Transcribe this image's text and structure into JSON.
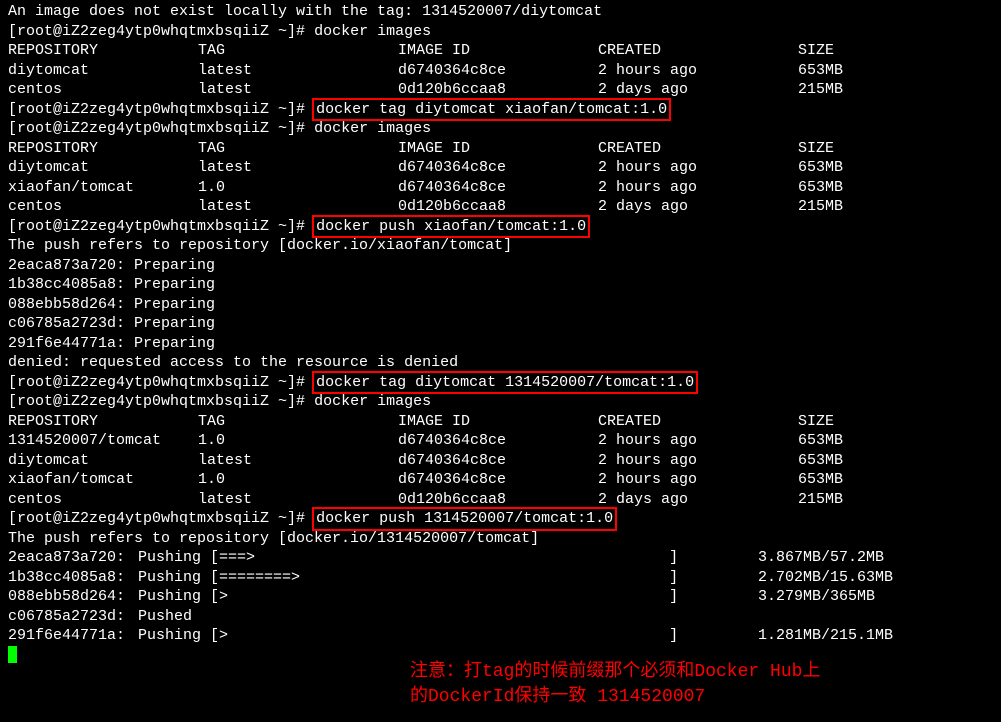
{
  "line_error": "An image does not exist locally with the tag: 1314520007/diytomcat",
  "prompt": "[root@iZ2zeg4ytp0whqtmxbsqiiZ ~]# ",
  "cmd_images": "docker images",
  "cmd_tag1": "docker tag diytomcat xiaofan/tomcat:1.0",
  "cmd_push1": "docker push xiaofan/tomcat:1.0",
  "cmd_tag2": "docker tag diytomcat 1314520007/tomcat:1.0",
  "cmd_push2": "docker push 1314520007/tomcat:1.0",
  "push_refers1": "The push refers to repository [docker.io/xiaofan/tomcat]",
  "push_refers2": "The push refers to repository [docker.io/1314520007/tomcat]",
  "denied": "denied: requested access to the resource is denied",
  "headers": {
    "repo": "REPOSITORY",
    "tag": "TAG",
    "imgid": "IMAGE ID",
    "created": "CREATED",
    "size": "SIZE"
  },
  "tables": {
    "t1": [
      {
        "repo": "diytomcat",
        "tag": "latest",
        "imgid": "d6740364c8ce",
        "created": "2 hours ago",
        "size": "653MB"
      },
      {
        "repo": "centos",
        "tag": "latest",
        "imgid": "0d120b6ccaa8",
        "created": "2 days ago",
        "size": "215MB"
      }
    ],
    "t2": [
      {
        "repo": "diytomcat",
        "tag": "latest",
        "imgid": "d6740364c8ce",
        "created": "2 hours ago",
        "size": "653MB"
      },
      {
        "repo": "xiaofan/tomcat",
        "tag": "1.0",
        "imgid": "d6740364c8ce",
        "created": "2 hours ago",
        "size": "653MB"
      },
      {
        "repo": "centos",
        "tag": "latest",
        "imgid": "0d120b6ccaa8",
        "created": "2 days ago",
        "size": "215MB"
      }
    ],
    "t3": [
      {
        "repo": "1314520007/tomcat",
        "tag": "1.0",
        "imgid": "d6740364c8ce",
        "created": "2 hours ago",
        "size": "653MB"
      },
      {
        "repo": "diytomcat",
        "tag": "latest",
        "imgid": "d6740364c8ce",
        "created": "2 hours ago",
        "size": "653MB"
      },
      {
        "repo": "xiaofan/tomcat",
        "tag": "1.0",
        "imgid": "d6740364c8ce",
        "created": "2 hours ago",
        "size": "653MB"
      },
      {
        "repo": "centos",
        "tag": "latest",
        "imgid": "0d120b6ccaa8",
        "created": "2 days ago",
        "size": "215MB"
      }
    ]
  },
  "preparing": [
    "2eaca873a720: Preparing",
    "1b38cc4085a8: Preparing",
    "088ebb58d264: Preparing",
    "c06785a2723d: Preparing",
    "291f6e44771a: Preparing"
  ],
  "pushing": [
    {
      "id": "2eaca873a720:",
      "status": "Pushing ",
      "bar": "[===>                                              ]",
      "size": "  3.867MB/57.2MB"
    },
    {
      "id": "1b38cc4085a8:",
      "status": "Pushing ",
      "bar": "[========>                                         ]",
      "size": "  2.702MB/15.63MB"
    },
    {
      "id": "088ebb58d264:",
      "status": "Pushing ",
      "bar": "[>                                                 ]",
      "size": "  3.279MB/365MB"
    },
    {
      "id": "c06785a2723d:",
      "status": "Pushed",
      "bar": "",
      "size": ""
    },
    {
      "id": "291f6e44771a:",
      "status": "Pushing ",
      "bar": "[>                                                 ]",
      "size": "  1.281MB/215.1MB"
    }
  ],
  "annotation": {
    "line1": "注意：打tag的时候前缀那个必须和Docker Hub上",
    "line2": "的DockerId保持一致 1314520007"
  }
}
